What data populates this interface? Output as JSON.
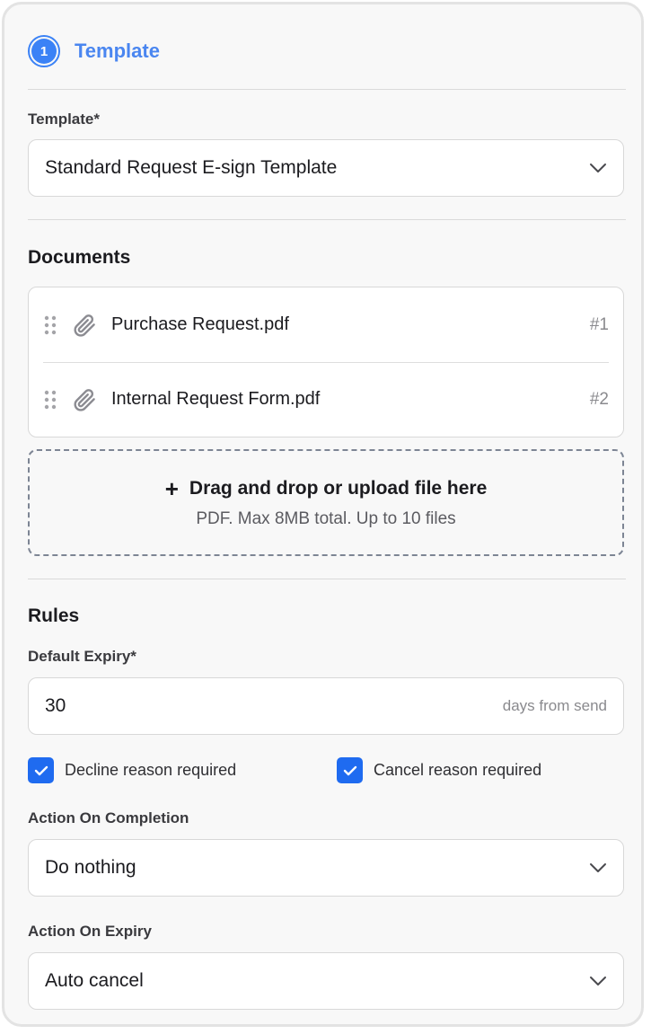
{
  "step": {
    "number": "1",
    "title": "Template"
  },
  "template_field": {
    "label": "Template*",
    "value": "Standard Request E-sign Template"
  },
  "documents": {
    "title": "Documents",
    "items": [
      {
        "name": "Purchase Request.pdf",
        "index": "#1"
      },
      {
        "name": "Internal Request Form.pdf",
        "index": "#2"
      }
    ],
    "dropzone": {
      "icon": "+",
      "main": "Drag and drop or upload file here",
      "sub": "PDF. Max 8MB total. Up to 10 files"
    }
  },
  "rules": {
    "title": "Rules",
    "expiry": {
      "label": "Default Expiry*",
      "value": "30",
      "suffix": "days from send"
    },
    "decline_reason": {
      "label": "Decline reason required",
      "checked": true
    },
    "cancel_reason": {
      "label": "Cancel reason required",
      "checked": true
    },
    "completion": {
      "label": "Action On Completion",
      "value": "Do nothing"
    },
    "on_expiry": {
      "label": "Action On Expiry",
      "value": "Auto cancel"
    }
  },
  "colors": {
    "accent": "#3b82f6",
    "checkbox": "#1f6bf0"
  }
}
